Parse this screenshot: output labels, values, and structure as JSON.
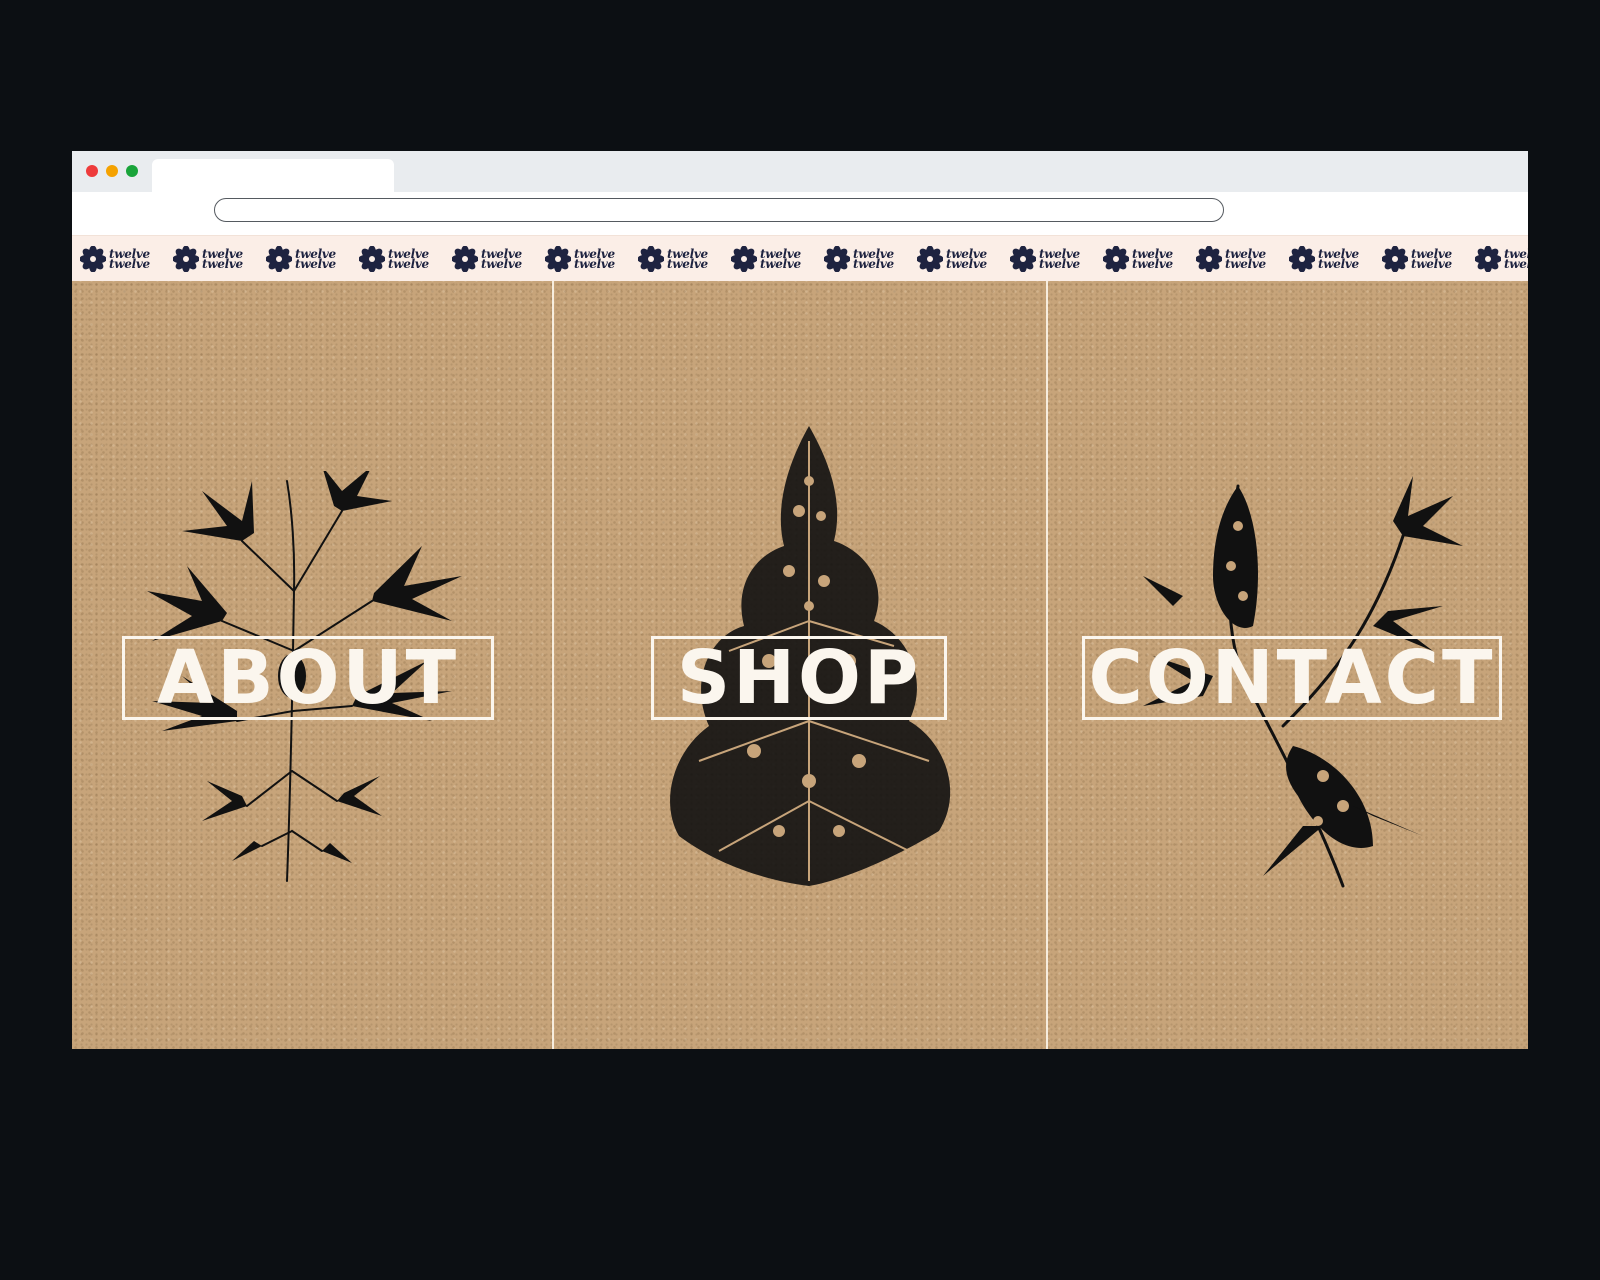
{
  "window": {
    "controls": [
      {
        "name": "close",
        "color": "#ee3b3b"
      },
      {
        "name": "minimize",
        "color": "#f5a200"
      },
      {
        "name": "maximize",
        "color": "#19a43a"
      }
    ]
  },
  "brand": {
    "wordmark_line1": "twelve",
    "wordmark_line2": "twelve",
    "repeat_count": 16,
    "color": "#1e2340",
    "icon": "flower-icon"
  },
  "nav": {
    "items": [
      {
        "label": "ABOUT",
        "illustration": "hemp-plant-illustration"
      },
      {
        "label": "SHOP",
        "illustration": "cannabis-bud-illustration"
      },
      {
        "label": "CONTACT",
        "illustration": "flowering-branch-illustration"
      }
    ]
  },
  "colors": {
    "kraft_background": "#c7a47a",
    "label_color": "#fbf6ee",
    "strip_background": "#fbeee7",
    "page_background": "#0c0f13"
  }
}
